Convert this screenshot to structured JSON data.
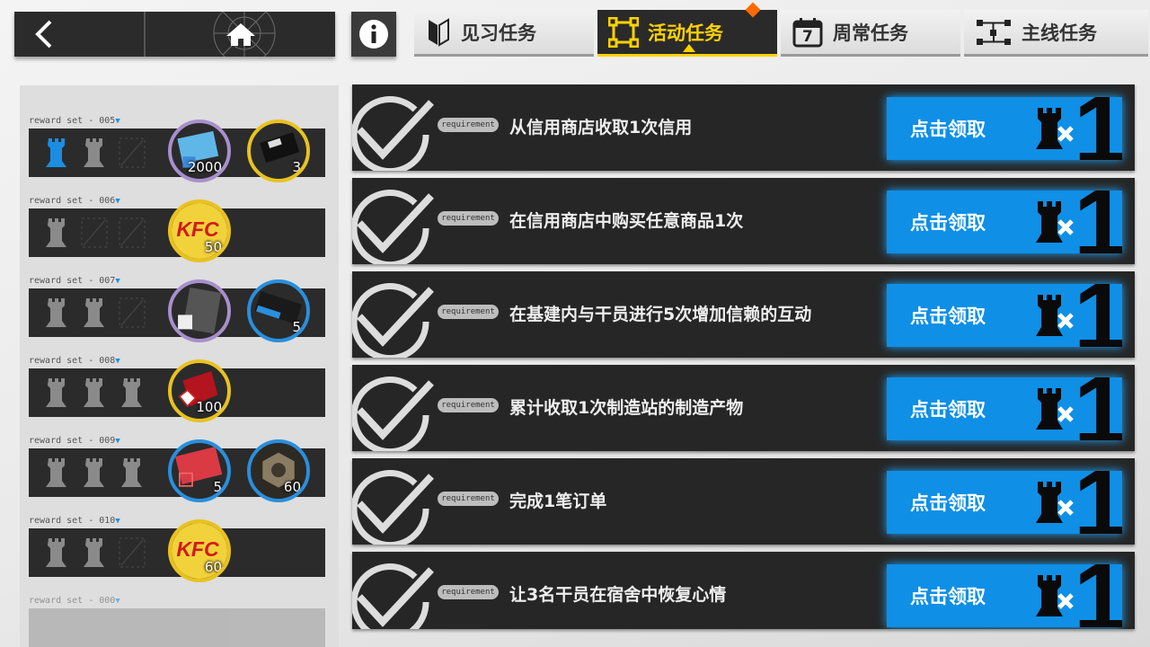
{
  "tabs": [
    {
      "label": "见习任务",
      "icon": "book-icon",
      "active": false
    },
    {
      "label": "活动任务",
      "icon": "frame-icon",
      "active": true
    },
    {
      "label": "周常任务",
      "icon": "calendar-icon",
      "icon_text": "7",
      "active": false
    },
    {
      "label": "主线任务",
      "icon": "flowchart-icon",
      "active": false
    }
  ],
  "reward_sets": [
    {
      "label": "reward set - 005",
      "items": [
        {
          "count": "2000",
          "icon": "device-card-icon"
        },
        {
          "count": "3",
          "icon": "chip-icon"
        }
      ]
    },
    {
      "label": "reward set - 006",
      "items": [
        {
          "count": "50",
          "icon": "kfc-icon"
        }
      ]
    },
    {
      "label": "reward set - 007",
      "items": [
        {
          "count": "",
          "icon": "furniture-pack-icon"
        },
        {
          "count": "5",
          "icon": "material-box-icon"
        }
      ]
    },
    {
      "label": "reward set - 008",
      "items": [
        {
          "count": "100",
          "icon": "red-crystal-icon"
        }
      ]
    },
    {
      "label": "reward set - 009",
      "items": [
        {
          "count": "5",
          "icon": "purchase-voucher-icon"
        },
        {
          "count": "60",
          "icon": "hex-nut-icon"
        }
      ]
    },
    {
      "label": "reward set - 010",
      "items": [
        {
          "count": "60",
          "icon": "kfc-icon"
        }
      ]
    },
    {
      "label": "reward set - 000",
      "items": []
    }
  ],
  "missions": [
    {
      "tag": "requirement",
      "desc": "从信用商店收取1次信用",
      "button": "点击领取",
      "reward_count": "1"
    },
    {
      "tag": "requirement",
      "desc": "在信用商店中购买任意商品1次",
      "button": "点击领取",
      "reward_count": "1"
    },
    {
      "tag": "requirement",
      "desc": "在基建内与干员进行5次增加信赖的互动",
      "button": "点击领取",
      "reward_count": "1"
    },
    {
      "tag": "requirement",
      "desc": "累计收取1次制造站的制造产物",
      "button": "点击领取",
      "reward_count": "1"
    },
    {
      "tag": "requirement",
      "desc": "完成1笔订单",
      "button": "点击领取",
      "reward_count": "1"
    },
    {
      "tag": "requirement",
      "desc": "让3名干员在宿舍中恢复心情",
      "button": "点击领取",
      "reward_count": "1"
    }
  ],
  "colors": {
    "accent": "#ffd200",
    "claim_blue": "#0f8fe6",
    "notif": "#ff6a00"
  }
}
